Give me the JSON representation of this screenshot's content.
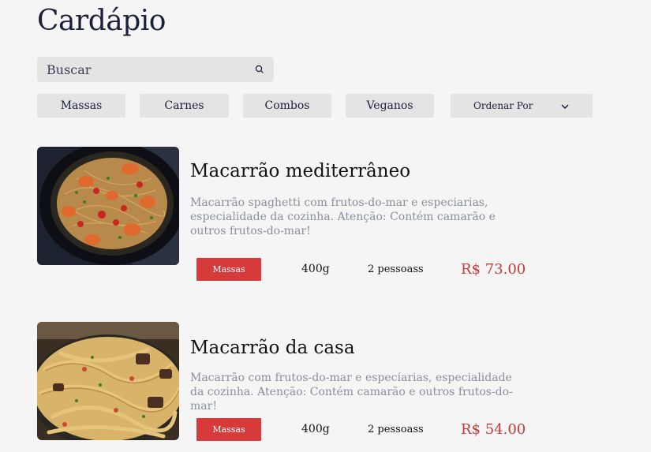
{
  "page": {
    "title": "Cardápio"
  },
  "search": {
    "placeholder": "Buscar"
  },
  "filters": [
    {
      "label": "Massas"
    },
    {
      "label": "Carnes"
    },
    {
      "label": "Combos"
    },
    {
      "label": "Veganos"
    }
  ],
  "sort": {
    "label": "Ordenar Por"
  },
  "dishes": [
    {
      "name": "Macarrão mediterrâneo",
      "description": "Macarrão spaghetti com frutos-do-mar e especiarias, especialidade da cozinha. Atenção: Contém camarão e outros frutos-do-mar!",
      "category": "Massas",
      "weight": "400g",
      "serves": "2 pessoass",
      "price": "R$ 73.00"
    },
    {
      "name": "Macarrão da casa",
      "description": "Macarrão com frutos-do-mar e especíarias, especialidade da cozinha. Atenção: Contém camarão e outros frutos-do-mar!",
      "category": "Massas",
      "weight": "400g",
      "serves": "2 pessoass",
      "price": "R$ 54.00"
    }
  ],
  "colors": {
    "accent": "#d63a3a",
    "price": "#c23a3a",
    "chip_bg": "#e4e4e4",
    "page_bg": "#f5f5f5"
  }
}
